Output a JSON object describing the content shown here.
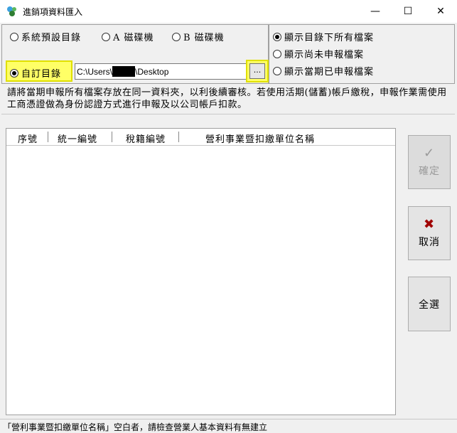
{
  "window": {
    "title": "進銷項資料匯入",
    "minimize": "—",
    "maximize": "☐",
    "close": "✕"
  },
  "source": {
    "opt_default": "系統預設目錄",
    "opt_a": "A 磁碟機",
    "opt_b": "B 磁碟機",
    "opt_custom": "自訂目錄",
    "path_prefix": "C:\\Users\\",
    "path_suffix": "\\Desktop",
    "browse_label": "..."
  },
  "filter": {
    "opt_all": "顯示目錄下所有檔案",
    "opt_unfiled": "顯示尚未申報檔案",
    "opt_filed": "顯示當期已申報檔案"
  },
  "notice": "請將當期申報所有檔案存放在同一資料夾，以利後續審核。若使用活期(儲蓄)帳戶繳稅，申報作業需使用工商憑證做為身份認證方式進行申報及以公司帳戶扣款。",
  "table": {
    "columns": [
      "序號",
      "統一編號",
      "稅籍編號",
      "營利事業暨扣繳單位名稱"
    ],
    "rows": []
  },
  "buttons": {
    "confirm": "確定",
    "confirm_icon": "✓",
    "cancel": "取消",
    "cancel_icon": "✖",
    "select_all": "全選"
  },
  "status": "「營利事業暨扣繳單位名稱」空白者，請檢查營業人基本資料有無建立",
  "colors": {
    "highlight": "#ffff66",
    "cancel_icon": "#a00000"
  }
}
